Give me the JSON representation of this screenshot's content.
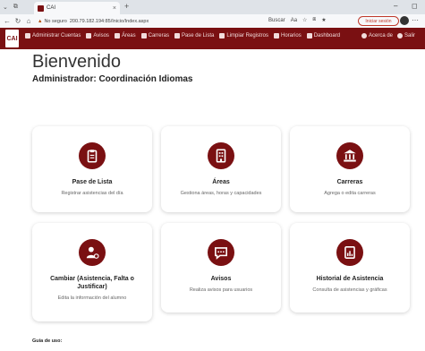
{
  "browser": {
    "tab_title": "CAI",
    "url_prefix": "No seguro",
    "url": "200.79.182.194:85/Inicio/Index.aspx",
    "tools_text": "Buscar",
    "session_label": "Iniciar sesión"
  },
  "app": {
    "logo_text": "CAI",
    "nav": [
      {
        "label": "Administrar Cuentas",
        "icon": "users-icon"
      },
      {
        "label": "Avisos",
        "icon": "bell-icon"
      },
      {
        "label": "Áreas",
        "icon": "building-icon"
      },
      {
        "label": "Carreras",
        "icon": "bank-icon"
      },
      {
        "label": "Pase de Lista",
        "icon": "clipboard-icon"
      },
      {
        "label": "Limpiar Registros",
        "icon": "trash-icon"
      },
      {
        "label": "Horarios",
        "icon": "clock-icon"
      },
      {
        "label": "Dashboard",
        "icon": "dashboard-icon"
      }
    ],
    "nav_right": [
      {
        "label": "Acerca de",
        "icon": "info-icon"
      },
      {
        "label": "Salir",
        "icon": "logout-icon"
      }
    ]
  },
  "page": {
    "title": "Bienvenido",
    "subtitle": "Administrador: Coordinación Idiomas",
    "guide": "Guía de uso:"
  },
  "cards": [
    {
      "title": "Pase de Lista",
      "desc": "Registrar asistencias del día",
      "icon": "clipboard-list-icon"
    },
    {
      "title": "Áreas",
      "desc": "Gestiona áreas, horas y capacidades",
      "icon": "building-icon"
    },
    {
      "title": "Carreras",
      "desc": "Agrega o edita carreras",
      "icon": "university-icon"
    },
    {
      "title": "Cambiar (Asistencia, Falta o Justificar)",
      "desc": "Edita la información del alumno",
      "icon": "user-cog-icon"
    },
    {
      "title": "Avisos",
      "desc": "Realiza avisos para usuarios",
      "icon": "message-icon"
    },
    {
      "title": "Historial de Asistencia",
      "desc": "Consulta de asistencias y gráficas",
      "icon": "report-icon"
    }
  ],
  "colors": {
    "brand": "#7a1012"
  }
}
